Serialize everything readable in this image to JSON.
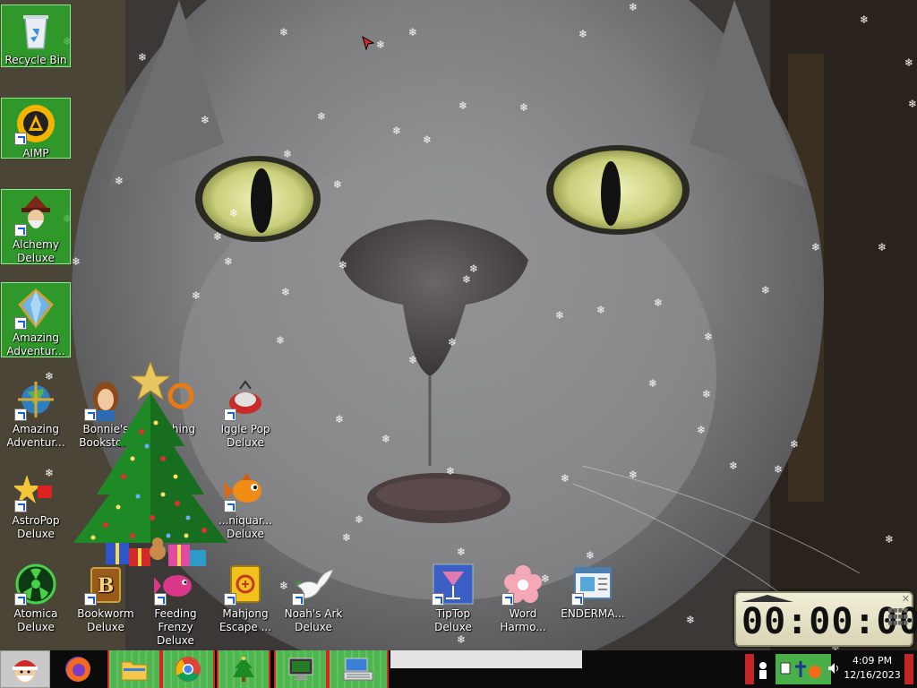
{
  "desktop": {
    "icons": [
      {
        "label": "Recycle Bin",
        "icon": "recycle-bin-icon"
      },
      {
        "label": "AIMP",
        "icon": "aimp-icon"
      },
      {
        "label": "Alchemy Deluxe",
        "icon": "alchemy-wizard-icon"
      },
      {
        "label": "Amazing Adventur...",
        "icon": "gem-icon"
      },
      {
        "label": "Amazing Adventur...",
        "icon": "globe-icon"
      },
      {
        "label": "Bonnie's Booksto...",
        "icon": "bonnie-icon"
      },
      {
        "label": "...ching",
        "icon": "ring-icon"
      },
      {
        "label": "Iggle Pop Deluxe",
        "icon": "iggle-pop-icon"
      },
      {
        "label": "AstroPop Deluxe",
        "icon": "astropop-icon"
      },
      {
        "label": "...niquar... Deluxe",
        "icon": "fish-icon"
      },
      {
        "label": "Atomica Deluxe",
        "icon": "atomica-icon"
      },
      {
        "label": "Bookworm Deluxe",
        "icon": "bookworm-icon"
      },
      {
        "label": "Feeding Frenzy Deluxe",
        "icon": "feeding-frenzy-icon"
      },
      {
        "label": "Mahjong Escape ...",
        "icon": "mahjong-icon"
      },
      {
        "label": "Noah's Ark Deluxe",
        "icon": "dove-icon"
      },
      {
        "label": "TipTop Deluxe",
        "icon": "cocktail-icon"
      },
      {
        "label": "Word Harmo...",
        "icon": "flower-icon"
      },
      {
        "label": "ENDERMA...",
        "icon": "window-app-icon"
      }
    ]
  },
  "timer_gadget": {
    "display": "00:00:00"
  },
  "taskbar": {
    "clock_time": "4:09 PM",
    "clock_date": "12/16/2023"
  },
  "colors": {
    "selection_green": "#4fb64f",
    "taskbar": "#0b0b0b",
    "accent_red": "#c42525"
  }
}
